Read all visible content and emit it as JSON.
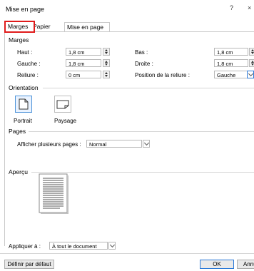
{
  "dialog": {
    "title": "Mise en page",
    "help_glyph": "?",
    "close_glyph": "×"
  },
  "tabs": [
    {
      "label": "Marges"
    },
    {
      "label": "Papier"
    },
    {
      "label": "Mise en page"
    }
  ],
  "marges": {
    "heading": "Marges",
    "left": [
      {
        "label": "Haut :",
        "value": "1,8 cm"
      },
      {
        "label": "Gauche :",
        "value": "1,8 cm"
      },
      {
        "label": "Reliure :",
        "value": "0 cm"
      }
    ],
    "right": [
      {
        "label": "Bas :",
        "value": "1,8 cm"
      },
      {
        "label": "Droite :",
        "value": "1,8 cm"
      },
      {
        "label": "Position de la reliure :",
        "value": "Gauche"
      }
    ]
  },
  "orientation": {
    "heading": "Orientation",
    "portrait": "Portrait",
    "paysage": "Paysage",
    "selected": "portrait"
  },
  "pages": {
    "heading": "Pages",
    "label": "Afficher plusieurs pages :",
    "value": "Normal"
  },
  "apercu": {
    "heading": "Aperçu"
  },
  "apply": {
    "label": "Appliquer à :",
    "value": "À tout le document"
  },
  "footer": {
    "default_button": "Définir par défaut",
    "ok_button": "OK",
    "cancel_button": "Annuler"
  },
  "colors": {
    "highlight": "#e01b1b",
    "accent": "#2b79d8"
  }
}
